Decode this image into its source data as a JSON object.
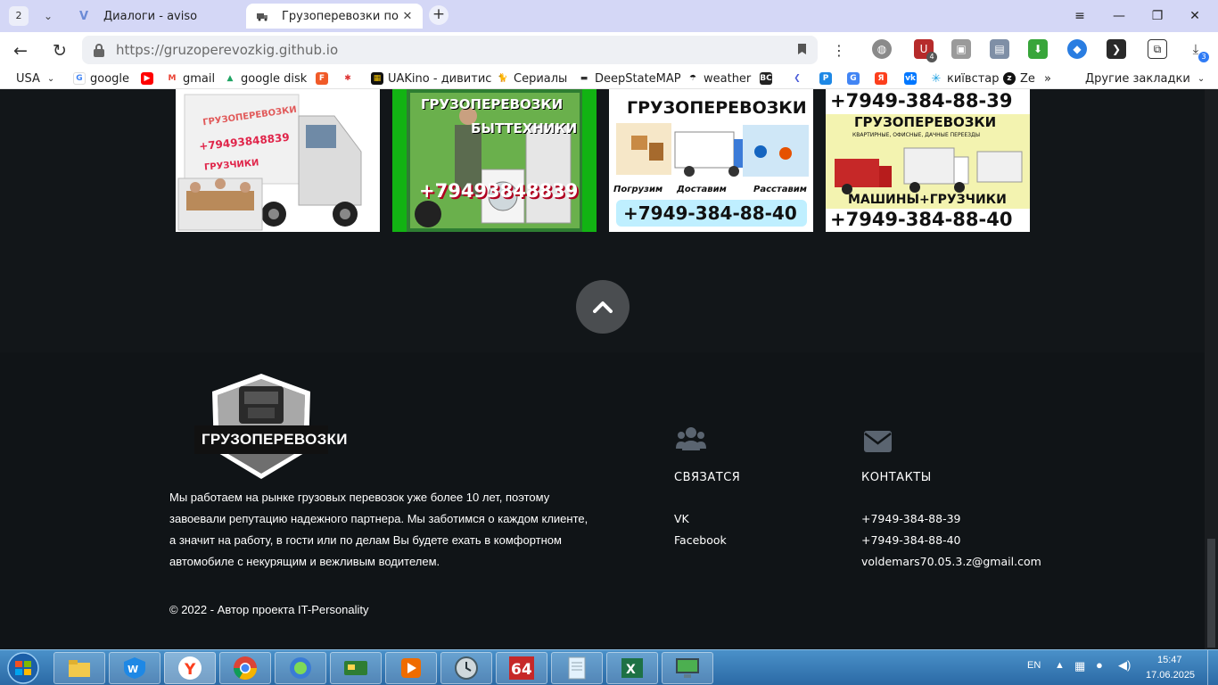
{
  "browser": {
    "tab_count": "2",
    "tabs": [
      {
        "title": "Диалоги - aviso",
        "active": false
      },
      {
        "title": "Грузоперевозки по Гор",
        "active": true
      }
    ],
    "url": "https://gruzoperevozkig.github.io",
    "extension_badges": {
      "ext1": "4",
      "downloads": "3"
    }
  },
  "bookmarks": {
    "region": "USA",
    "items": [
      {
        "label": "google",
        "icon": "google-icon"
      },
      {
        "label": "",
        "icon": "youtube-icon"
      },
      {
        "label": "gmail",
        "icon": "gmail-icon"
      },
      {
        "label": "google disk",
        "icon": "google-drive-icon"
      },
      {
        "label": "",
        "icon": "f-icon"
      },
      {
        "label": "",
        "icon": "puzzle-star-icon"
      },
      {
        "label": "UAKino - дивитис",
        "icon": "uakino-icon"
      },
      {
        "label": "Сериалы",
        "icon": "cat-icon"
      },
      {
        "label": "DeepStateMAP",
        "icon": "deepstate-icon"
      },
      {
        "label": "weather",
        "icon": "weather-icon"
      },
      {
        "label": "",
        "icon": "bc-icon"
      },
      {
        "label": "",
        "icon": "arrow-icon"
      },
      {
        "label": "",
        "icon": "p-icon"
      },
      {
        "label": "",
        "icon": "translate-icon"
      },
      {
        "label": "",
        "icon": "yandex-icon"
      },
      {
        "label": "",
        "icon": "vk-icon"
      },
      {
        "label": "київстар",
        "icon": "kyivstar-icon"
      },
      {
        "label": "Ze",
        "icon": "ze-icon"
      }
    ],
    "more": "»",
    "other_bookmarks": "Другие закладки"
  },
  "banners": [
    {
      "lines": [
        "ГРУЗОПЕРЕВОЗКИ",
        "+79493848839",
        "ГРУЗЧИКИ"
      ]
    },
    {
      "lines": [
        "ГРУЗОПЕРЕВОЗКИ",
        "БЫТТЕХНИКИ",
        "+79493848839"
      ]
    },
    {
      "lines": [
        "ГРУЗОПЕРЕВОЗКИ",
        "Погрузим",
        "Доставим",
        "Расставим",
        "+7949-384-88-40"
      ]
    },
    {
      "lines": [
        "+7949-384-88-39",
        "ГРУЗОПЕРЕВОЗКИ",
        "КВАРТИРНЫЕ, ОФИСНЫЕ, ДАЧНЫЕ ПЕРЕЕЗДЫ",
        "МАШИНЫ+ГРУЗЧИКИ",
        "+7949-384-88-40"
      ]
    }
  ],
  "footer": {
    "logo_text": "ГРУЗОПЕРЕВОЗКИ",
    "about": "Мы работаем на рынке грузовых перевозок уже более 10 лет, поэтому завоевали репутацию надежного партнера. Мы заботимся о каждом клиенте, а значит на работу, в гости или по делам Вы будете ехать в комфортном автомобиле с некурящим и вежливым водителем.",
    "copyright": "© 2022 - Автор проекта IT-Personality",
    "connect": {
      "title": "СВЯЗАТСЯ",
      "links": [
        "VK",
        "Facebook"
      ]
    },
    "contacts": {
      "title": "КОНТАКТЫ",
      "items": [
        "+7949-384-88-39",
        "+7949-384-88-40",
        "voldemars70.05.3.z@gmail.com"
      ]
    }
  },
  "taskbar": {
    "language": "EN",
    "time": "15:47",
    "date": "17.06.2025"
  }
}
